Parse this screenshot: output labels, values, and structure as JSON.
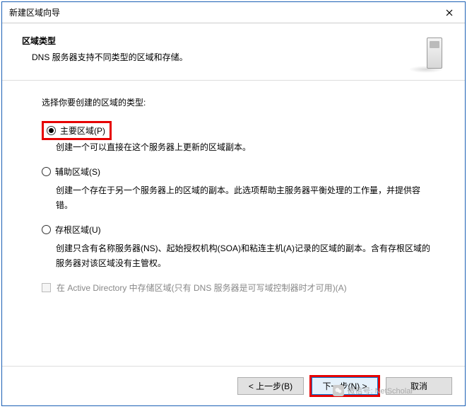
{
  "titlebar": {
    "title": "新建区域向导"
  },
  "header": {
    "title": "区域类型",
    "subtitle": "DNS 服务器支持不同类型的区域和存储。"
  },
  "prompt": "选择你要创建的区域的类型:",
  "options": {
    "primary": {
      "label": "主要区域(P)",
      "desc": "创建一个可以直接在这个服务器上更新的区域副本。"
    },
    "secondary": {
      "label": "辅助区域(S)",
      "desc": "创建一个存在于另一个服务器上的区域的副本。此选项帮助主服务器平衡处理的工作量，并提供容错。"
    },
    "stub": {
      "label": "存根区域(U)",
      "desc": "创建只含有名称服务器(NS)、起始授权机构(SOA)和粘连主机(A)记录的区域的副本。含有存根区域的服务器对该区域没有主管权。"
    }
  },
  "adCheckbox": {
    "label": "在 Active Directory 中存储区域(只有 DNS 服务器是可写域控制器时才可用)(A)"
  },
  "footer": {
    "back": "< 上一步(B)",
    "next": "下一步(N) >",
    "cancel": "取消"
  },
  "watermark": {
    "text": "微信号: NetScholar"
  }
}
